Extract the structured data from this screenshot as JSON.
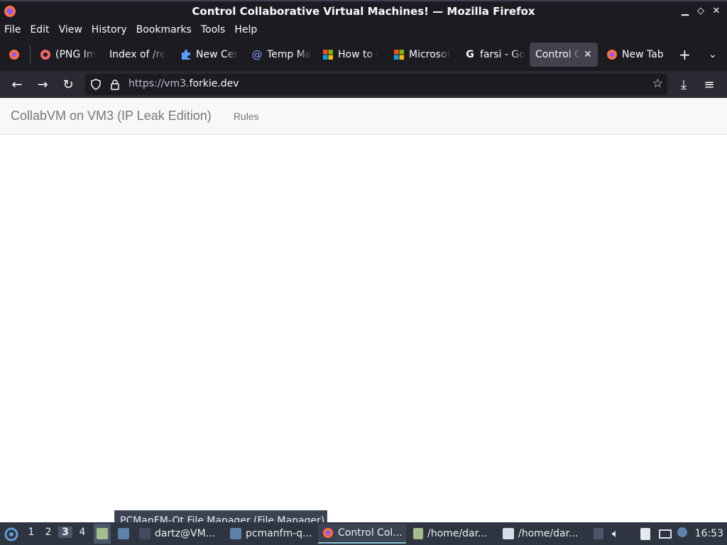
{
  "window": {
    "title": "Control Collaborative Virtual Machines! — Mozilla Firefox",
    "controls": [
      "minimize",
      "maximize",
      "close"
    ]
  },
  "menu": [
    "File",
    "Edit",
    "View",
    "History",
    "Bookmarks",
    "Tools",
    "Help"
  ],
  "tabs": [
    {
      "label": "(PNG Im",
      "icon": "red-circle-icon"
    },
    {
      "label": "Index of /re",
      "icon": ""
    },
    {
      "label": "New Cer",
      "icon": "puzzle-icon"
    },
    {
      "label": "Temp Ma",
      "icon": "at-icon"
    },
    {
      "label": "How to i",
      "icon": "microsoft-icon"
    },
    {
      "label": "Microsof",
      "icon": "microsoft-icon"
    },
    {
      "label": "farsi - Go",
      "icon": "google-icon"
    },
    {
      "label": "Control Co",
      "icon": "",
      "active": true
    },
    {
      "label": "New Tab",
      "icon": "firefox-icon"
    }
  ],
  "nav": {
    "url_prefix": "https://vm3.",
    "url_domain": "forkie.dev"
  },
  "page": {
    "brand": "CollabVM on VM3 (IP Leak Edition)",
    "rules": "Rules"
  },
  "taskbar": {
    "workspaces": [
      "1",
      "2",
      "3",
      "4"
    ],
    "active_workspace": "3",
    "items": [
      {
        "label": "dartz@VM..."
      },
      {
        "label": "pcmanfm-q..."
      },
      {
        "label": "Control Col..."
      },
      {
        "label": "/home/dar..."
      },
      {
        "label": "/home/dar..."
      }
    ],
    "clock": "16:53",
    "tooltip": "PCManFM-Qt File Manager (File Manager)"
  }
}
